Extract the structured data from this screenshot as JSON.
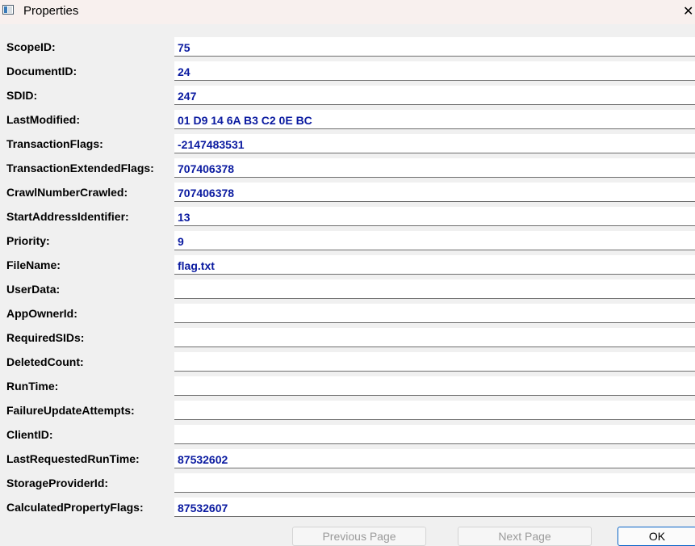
{
  "window": {
    "title": "Properties",
    "close_glyph": "✕",
    "icon": "properties-window-icon"
  },
  "properties": [
    {
      "label": "ScopeID:",
      "value": "75"
    },
    {
      "label": "DocumentID:",
      "value": "24"
    },
    {
      "label": "SDID:",
      "value": "247"
    },
    {
      "label": "LastModified:",
      "value": "01 D9 14 6A B3 C2 0E BC"
    },
    {
      "label": "TransactionFlags:",
      "value": "-2147483531"
    },
    {
      "label": "TransactionExtendedFlags:",
      "value": "707406378"
    },
    {
      "label": "CrawlNumberCrawled:",
      "value": "707406378"
    },
    {
      "label": "StartAddressIdentifier:",
      "value": "13"
    },
    {
      "label": "Priority:",
      "value": "9"
    },
    {
      "label": "FileName:",
      "value": "flag.txt"
    },
    {
      "label": "UserData:",
      "value": ""
    },
    {
      "label": "AppOwnerId:",
      "value": ""
    },
    {
      "label": "RequiredSIDs:",
      "value": ""
    },
    {
      "label": "DeletedCount:",
      "value": ""
    },
    {
      "label": "RunTime:",
      "value": ""
    },
    {
      "label": "FailureUpdateAttempts:",
      "value": ""
    },
    {
      "label": "ClientID:",
      "value": ""
    },
    {
      "label": "LastRequestedRunTime:",
      "value": "87532602"
    },
    {
      "label": "StorageProviderId:",
      "value": ""
    },
    {
      "label": "CalculatedPropertyFlags:",
      "value": "87532607"
    }
  ],
  "buttons": {
    "previous": "Previous Page",
    "next": "Next Page",
    "ok": "OK"
  },
  "colors": {
    "value_text": "#0a1aa0",
    "background": "#f0f0f0",
    "titlebar": "#f8f0ee",
    "ok_border": "#0a64c8"
  }
}
